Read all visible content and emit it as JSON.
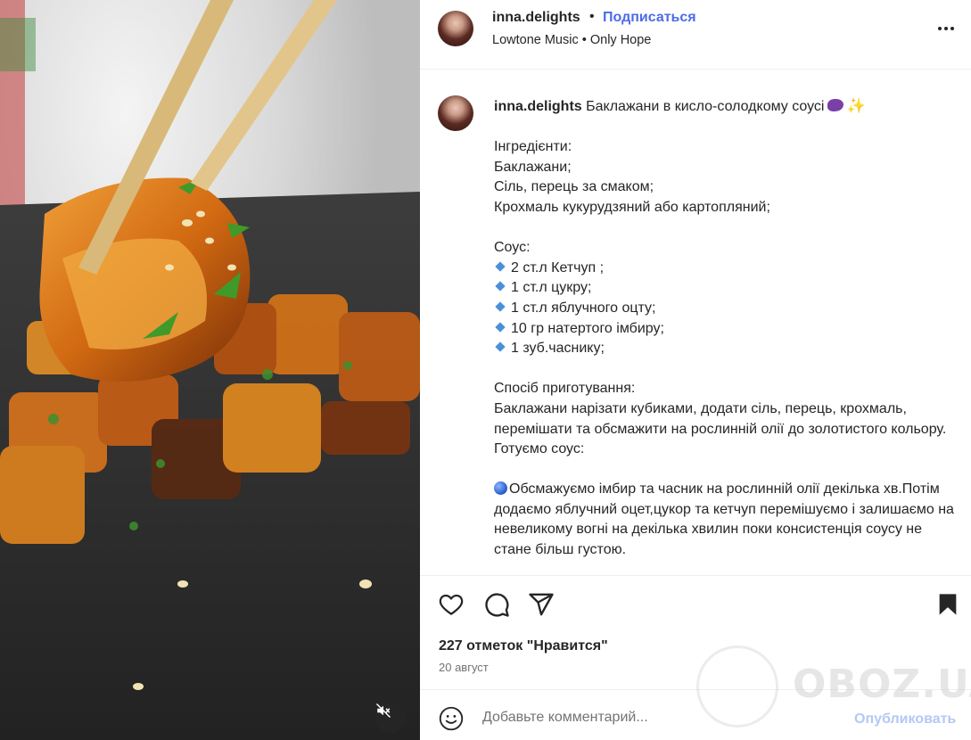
{
  "post": {
    "username": "inna.delights",
    "separator": "•",
    "follow_label": "Подписаться",
    "audio": "Lowtone Music • Only Hope"
  },
  "caption": {
    "username": "inna.delights",
    "title": "Баклажани в кисло-солодкому соусі",
    "ingredients_heading": "Інгредієнти:",
    "ingredients": [
      "Баклажани;",
      "Сіль, перець за смаком;",
      "Крохмаль кукурудзяний або картопляний;"
    ],
    "sauce_heading": "Соус:",
    "sauce_items": [
      "2 ст.л Кетчуп ;",
      "1 ст.л цукру;",
      "1 ст.л яблучного оцту;",
      "10 гр натертого імбиру;",
      "1 зуб.часнику;"
    ],
    "method_heading": "Спосіб приготування:",
    "method_text": "Баклажани нарізати кубиками, додати сіль, перець, крохмаль, перемішати та обсмажити на рослинній олії до золотистого кольору.",
    "sauce_step_heading": "Готуємо соус:",
    "sauce_step": "Обсмажуємо імбир та часник на рослинній олії декілька хв.Потім додаємо яблучний оцет,цукор та кетчуп перемішуємо і залишаємо на невеликому вогні на декілька хвилин поки консистенція соусу не стане більш густою."
  },
  "engagement": {
    "likes": "227 отметок \"Нравится\"",
    "date": "20 август"
  },
  "comment_box": {
    "placeholder": "Добавьте комментарий...",
    "publish_label": "Опубликовать"
  },
  "watermark": {
    "text": "OBOZ.UA"
  },
  "icons": {
    "more": "more-horizontal-icon",
    "like": "heart-icon",
    "comment": "comment-bubble-icon",
    "share": "paper-plane-icon",
    "save": "bookmark-icon",
    "emoji": "smiley-icon",
    "mute": "speaker-muted-icon"
  },
  "colors": {
    "accent": "#4c6ce8",
    "publish_disabled": "#b3c8f5",
    "text": "#262626",
    "muted": "#737373"
  }
}
